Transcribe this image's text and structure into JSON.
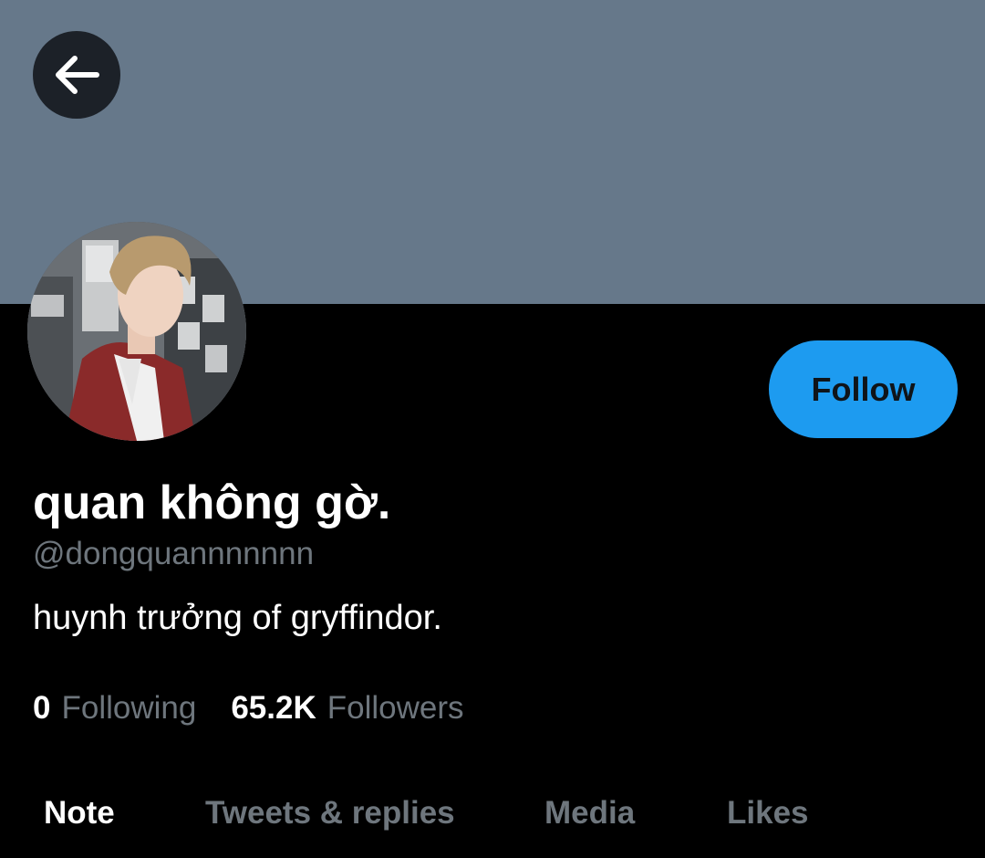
{
  "header": {
    "banner_color": "#66788a",
    "back_icon": "arrow-left-icon"
  },
  "profile": {
    "display_name": "quan không gờ.",
    "handle": "@dongquannnnnnn",
    "bio": "huynh trưởng of gryffindor.",
    "follow_label": "Follow",
    "accent_color": "#1d9bf0"
  },
  "stats": {
    "following_count": "0",
    "following_label": "Following",
    "followers_count": "65.2K",
    "followers_label": "Followers"
  },
  "tabs": [
    {
      "label": "Note",
      "active": true
    },
    {
      "label": "Tweets & replies",
      "active": false
    },
    {
      "label": "Media",
      "active": false
    },
    {
      "label": "Likes",
      "active": false
    }
  ]
}
